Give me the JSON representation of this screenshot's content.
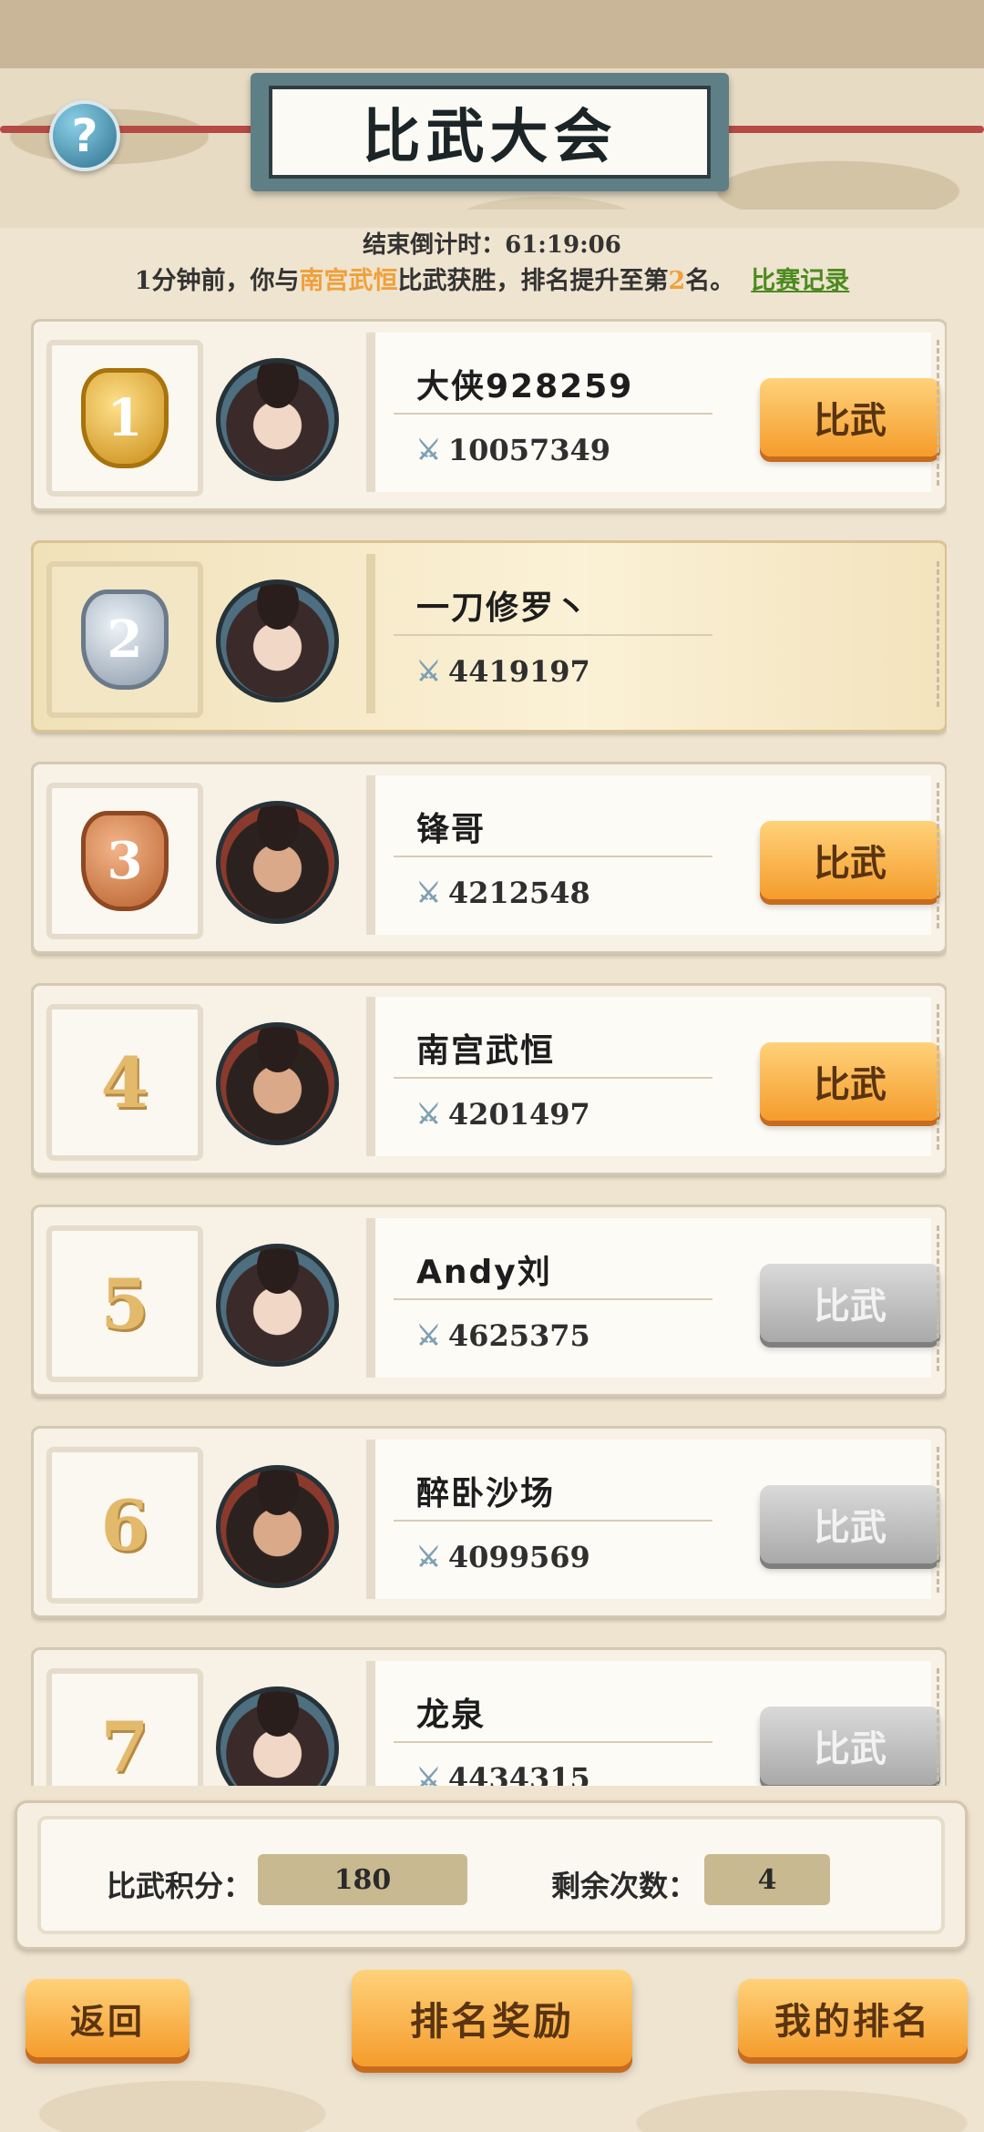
{
  "header": {
    "title": "比武大会",
    "help_symbol": "?",
    "countdown_label": "结束倒计时：",
    "countdown_value": "61:19:06"
  },
  "news": {
    "prefix": "1分钟前，你与",
    "opponent": "南宫武恒",
    "middle": "比武获胜，排名提升至第",
    "rank": "2",
    "suffix": "名。",
    "record_link": "比赛记录"
  },
  "rankings": [
    {
      "rank": "1",
      "name": "大侠928259",
      "power": "10057349",
      "button": "比武",
      "button_enabled": true,
      "medal": "gold",
      "avatar": "female",
      "is_self": false
    },
    {
      "rank": "2",
      "name": "一刀修罗丶",
      "power": "4419197",
      "button": "",
      "button_enabled": false,
      "medal": "silver",
      "avatar": "female",
      "is_self": true
    },
    {
      "rank": "3",
      "name": "锋哥",
      "power": "4212548",
      "button": "比武",
      "button_enabled": true,
      "medal": "bronze",
      "avatar": "male",
      "is_self": false
    },
    {
      "rank": "4",
      "name": "南宫武恒",
      "power": "4201497",
      "button": "比武",
      "button_enabled": true,
      "medal": "",
      "avatar": "male",
      "is_self": false
    },
    {
      "rank": "5",
      "name": "Andy刘",
      "power": "4625375",
      "button": "比武",
      "button_enabled": false,
      "medal": "",
      "avatar": "female",
      "is_self": false
    },
    {
      "rank": "6",
      "name": "醉卧沙场",
      "power": "4099569",
      "button": "比武",
      "button_enabled": false,
      "medal": "",
      "avatar": "male",
      "is_self": false
    },
    {
      "rank": "7",
      "name": "龙泉",
      "power": "4434315",
      "button": "比武",
      "button_enabled": false,
      "medal": "",
      "avatar": "female",
      "is_self": false
    }
  ],
  "stats": {
    "points_label": "比武积分：",
    "points_value": "180",
    "remaining_label": "剩余次数：",
    "remaining_value": "4"
  },
  "footer": {
    "back": "返回",
    "rewards": "排名奖励",
    "my_rank": "我的排名"
  },
  "colors": {
    "accent_orange": "#f59c2c",
    "highlight_text": "#f0a03c",
    "link_green": "#4c8a20",
    "disabled_gray": "#a9a9a9"
  },
  "icons": {
    "help": "help-icon",
    "power": "crossed-swords-icon",
    "medal": "rank-medal-icon"
  }
}
